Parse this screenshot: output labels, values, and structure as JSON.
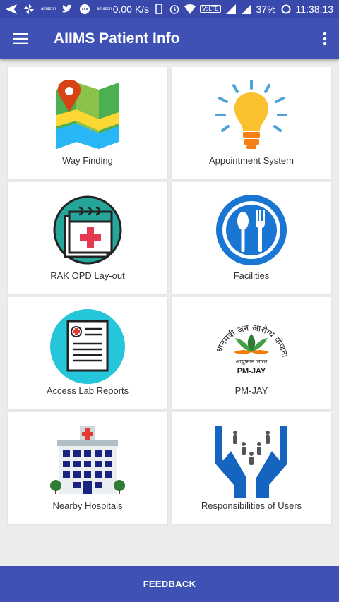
{
  "status_bar": {
    "speed": "0.00 K/s",
    "battery": "37%",
    "time": "11:38:13",
    "network_badge": "VoLTE",
    "notif_amazon": "amazon"
  },
  "app_bar": {
    "title": "AIIMS Patient Info",
    "menu_icon": "hamburger-menu-icon",
    "overflow_icon": "more-vertical-icon"
  },
  "tiles": [
    {
      "label": "Way Finding",
      "icon": "map-pin-icon"
    },
    {
      "label": "Appointment System",
      "icon": "light-bulb-icon"
    },
    {
      "label": "RAK OPD Lay-out",
      "icon": "medical-calendar-icon"
    },
    {
      "label": "Facilities",
      "icon": "spoon-fork-icon"
    },
    {
      "label": "Access Lab Reports",
      "icon": "lab-report-icon"
    },
    {
      "label": "PM-JAY",
      "icon": "pmjay-logo"
    },
    {
      "label": "Nearby Hospitals",
      "icon": "hospital-building-icon"
    },
    {
      "label": "Responsibilities of Users",
      "icon": "hands-people-icon"
    }
  ],
  "pmjay_logo": {
    "hindi_arc": "प्रधानमंत्री जन आरोग्य योजना",
    "tagline": "आयुष्मान भारत",
    "abbr": "PM-JAY"
  },
  "footer": {
    "feedback_label": "FEEDBACK"
  },
  "colors": {
    "primary": "#3f51b5",
    "primary_dark": "#3949ab",
    "background": "#ececec"
  }
}
